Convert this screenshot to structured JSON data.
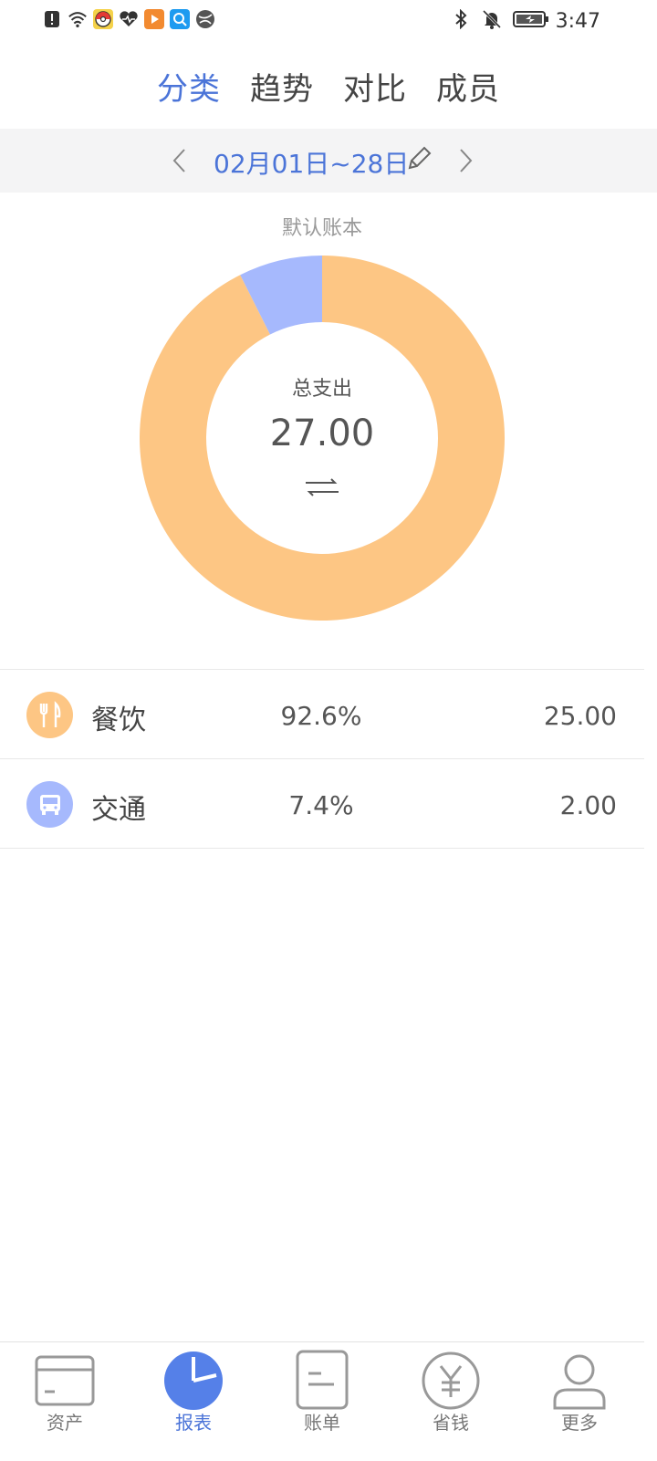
{
  "status_bar": {
    "time": "3:47",
    "left_icons": [
      "alert-icon",
      "wifi-icon",
      "app-pokeball-icon",
      "health-icon",
      "video-app-icon",
      "search-app-icon",
      "browser-icon"
    ],
    "right_icons": [
      "bluetooth-icon",
      "mute-bell-icon",
      "battery-icon"
    ]
  },
  "tabs": [
    {
      "label": "分类",
      "active": true
    },
    {
      "label": "趋势",
      "active": false
    },
    {
      "label": "对比",
      "active": false
    },
    {
      "label": "成员",
      "active": false
    }
  ],
  "date_range": {
    "text": "02月01日~28日"
  },
  "chart": {
    "book_name": "默认账本",
    "center_label": "总支出",
    "center_value": "27.00"
  },
  "chart_data": {
    "type": "pie",
    "categories": [
      "餐饮",
      "交通"
    ],
    "values": [
      25.0,
      2.0
    ],
    "colors": [
      "#fdc684",
      "#a6b9fd"
    ]
  },
  "categories": [
    {
      "name": "餐饮",
      "percent": "92.6%",
      "amount": "25.00",
      "icon": "fork-knife-icon",
      "color": "#fdc684"
    },
    {
      "name": "交通",
      "percent": "7.4%",
      "amount": "2.00",
      "icon": "bus-icon",
      "color": "#a6b9fd"
    }
  ],
  "bottom_nav": [
    {
      "label": "资产",
      "icon": "card-icon",
      "active": false
    },
    {
      "label": "报表",
      "icon": "pie-chart-icon",
      "active": true
    },
    {
      "label": "账单",
      "icon": "bill-icon",
      "active": false
    },
    {
      "label": "省钱",
      "icon": "yen-icon",
      "active": false
    },
    {
      "label": "更多",
      "icon": "person-icon",
      "active": false
    }
  ],
  "colors": {
    "accent": "#4b74d8",
    "food": "#fdc684",
    "transport": "#a6b9fd"
  }
}
